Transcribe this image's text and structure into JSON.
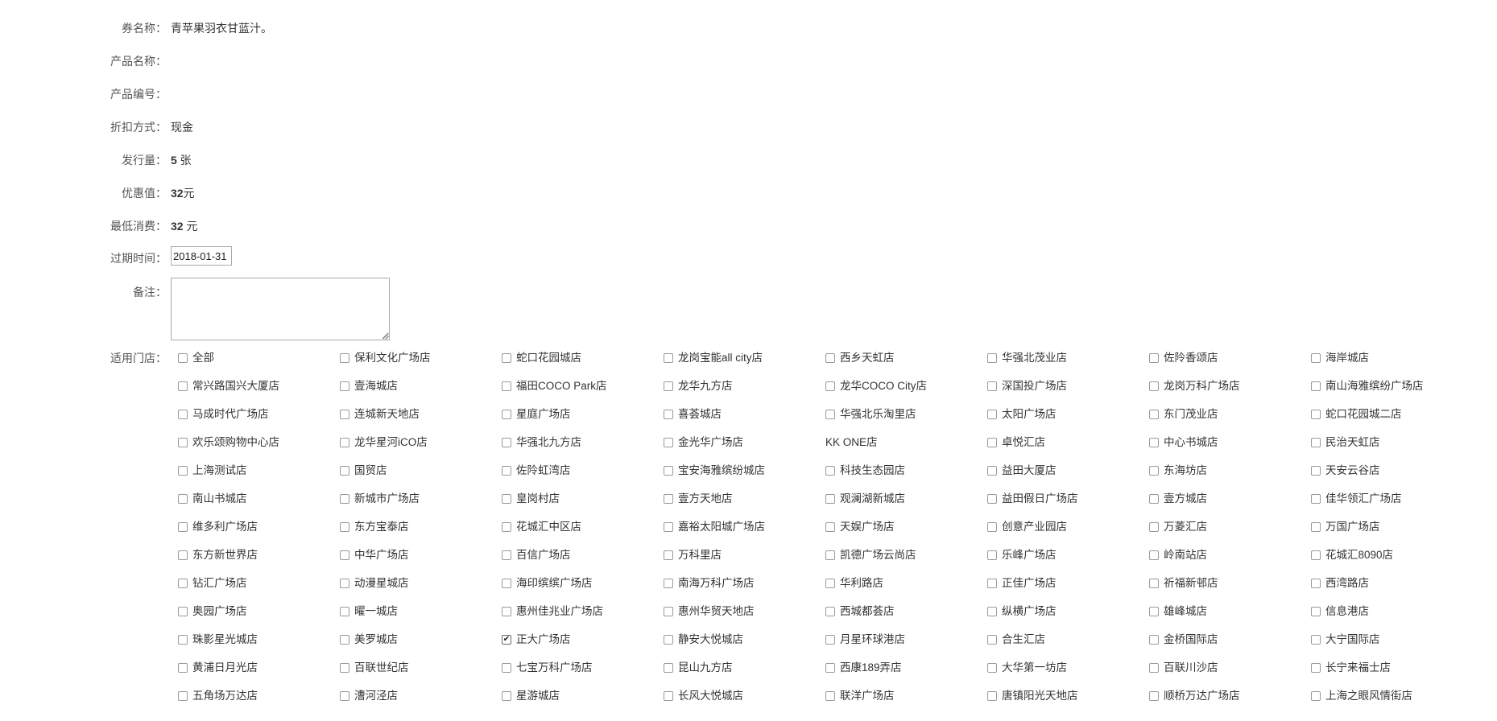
{
  "form": {
    "coupon_name": {
      "label": "券名称：",
      "value": "青苹果羽衣甘蓝汁。"
    },
    "product_name": {
      "label": "产品名称：",
      "value": ""
    },
    "product_code": {
      "label": "产品编号：",
      "value": ""
    },
    "discount_type": {
      "label": "折扣方式：",
      "value": "现金"
    },
    "issue_qty": {
      "label": "发行量：",
      "value": "5",
      "unit": " 张"
    },
    "discount_value": {
      "label": "优惠值：",
      "value": "32",
      "unit": "元"
    },
    "min_spend": {
      "label": "最低消费：",
      "value": "32",
      "unit": " 元"
    },
    "expiry": {
      "label": "过期时间：",
      "value": "2018-01-31"
    },
    "note": {
      "label": "备注：",
      "value": ""
    },
    "stores_label": "适用门店："
  },
  "stores": [
    {
      "name": "全部",
      "checked": false
    },
    {
      "name": "保利文化广场店",
      "checked": false
    },
    {
      "name": "蛇口花园城店",
      "checked": false
    },
    {
      "name": "龙岗宝能all city店",
      "checked": false
    },
    {
      "name": "西乡天虹店",
      "checked": false
    },
    {
      "name": "华强北茂业店",
      "checked": false
    },
    {
      "name": "佐阾香颂店",
      "checked": false
    },
    {
      "name": "海岸城店",
      "checked": false
    },
    {
      "name": "常兴路国兴大厦店",
      "checked": false
    },
    {
      "name": "壹海城店",
      "checked": false
    },
    {
      "name": "福田COCO Park店",
      "checked": false
    },
    {
      "name": "龙华九方店",
      "checked": false
    },
    {
      "name": "龙华COCO City店",
      "checked": false
    },
    {
      "name": "深国投广场店",
      "checked": false
    },
    {
      "name": "龙岗万科广场店",
      "checked": false
    },
    {
      "name": "南山海雅缤纷广场店",
      "checked": false
    },
    {
      "name": "马成时代广场店",
      "checked": false
    },
    {
      "name": "连城新天地店",
      "checked": false
    },
    {
      "name": "星庭广场店",
      "checked": false
    },
    {
      "name": "喜荟城店",
      "checked": false
    },
    {
      "name": "华强北乐淘里店",
      "checked": false
    },
    {
      "name": "太阳广场店",
      "checked": false
    },
    {
      "name": "东门茂业店",
      "checked": false
    },
    {
      "name": "蛇口花园城二店",
      "checked": false
    },
    {
      "name": "欢乐颂购物中心店",
      "checked": false
    },
    {
      "name": "龙华星河iCO店",
      "checked": false
    },
    {
      "name": "华强北九方店",
      "checked": false
    },
    {
      "name": "金光华广场店",
      "checked": false
    },
    {
      "name": "KK ONE店",
      "checked": false,
      "no_checkbox": true
    },
    {
      "name": "卓悦汇店",
      "checked": false
    },
    {
      "name": "中心书城店",
      "checked": false
    },
    {
      "name": "民治天虹店",
      "checked": false
    },
    {
      "name": "上海测试店",
      "checked": false
    },
    {
      "name": "国贸店",
      "checked": false
    },
    {
      "name": "佐阾虹湾店",
      "checked": false
    },
    {
      "name": "宝安海雅缤纷城店",
      "checked": false
    },
    {
      "name": "科技生态园店",
      "checked": false
    },
    {
      "name": "益田大厦店",
      "checked": false
    },
    {
      "name": "东海坊店",
      "checked": false
    },
    {
      "name": "天安云谷店",
      "checked": false
    },
    {
      "name": "南山书城店",
      "checked": false
    },
    {
      "name": "新城市广场店",
      "checked": false
    },
    {
      "name": "皇岗村店",
      "checked": false
    },
    {
      "name": "壹方天地店",
      "checked": false
    },
    {
      "name": "观澜湖新城店",
      "checked": false
    },
    {
      "name": "益田假日广场店",
      "checked": false
    },
    {
      "name": "壹方城店",
      "checked": false
    },
    {
      "name": "佳华领汇广场店",
      "checked": false
    },
    {
      "name": "维多利广场店",
      "checked": false
    },
    {
      "name": "东方宝泰店",
      "checked": false
    },
    {
      "name": "花城汇中区店",
      "checked": false
    },
    {
      "name": "嘉裕太阳城广场店",
      "checked": false
    },
    {
      "name": "天娱广场店",
      "checked": false
    },
    {
      "name": "创意产业园店",
      "checked": false
    },
    {
      "name": "万菱汇店",
      "checked": false
    },
    {
      "name": "万国广场店",
      "checked": false
    },
    {
      "name": "东方新世界店",
      "checked": false
    },
    {
      "name": "中华广场店",
      "checked": false
    },
    {
      "name": "百信广场店",
      "checked": false
    },
    {
      "name": "万科里店",
      "checked": false
    },
    {
      "name": "凯德广场云尚店",
      "checked": false
    },
    {
      "name": "乐峰广场店",
      "checked": false
    },
    {
      "name": "岭南站店",
      "checked": false
    },
    {
      "name": "花城汇8090店",
      "checked": false
    },
    {
      "name": "钻汇广场店",
      "checked": false
    },
    {
      "name": "动漫星城店",
      "checked": false
    },
    {
      "name": "海印缤缤广场店",
      "checked": false
    },
    {
      "name": "南海万科广场店",
      "checked": false
    },
    {
      "name": "华利路店",
      "checked": false
    },
    {
      "name": "正佳广场店",
      "checked": false
    },
    {
      "name": "祈福新邨店",
      "checked": false
    },
    {
      "name": "西湾路店",
      "checked": false
    },
    {
      "name": "奥园广场店",
      "checked": false
    },
    {
      "name": "曜一城店",
      "checked": false
    },
    {
      "name": "惠州佳兆业广场店",
      "checked": false
    },
    {
      "name": "惠州华贸天地店",
      "checked": false
    },
    {
      "name": "西城都荟店",
      "checked": false
    },
    {
      "name": "纵横广场店",
      "checked": false
    },
    {
      "name": "雄峰城店",
      "checked": false
    },
    {
      "name": "信息港店",
      "checked": false
    },
    {
      "name": "珠影星光城店",
      "checked": false
    },
    {
      "name": "美罗城店",
      "checked": false
    },
    {
      "name": "正大广场店",
      "checked": true
    },
    {
      "name": "静安大悦城店",
      "checked": false
    },
    {
      "name": "月星环球港店",
      "checked": false
    },
    {
      "name": "合生汇店",
      "checked": false
    },
    {
      "name": "金桥国际店",
      "checked": false
    },
    {
      "name": "大宁国际店",
      "checked": false
    },
    {
      "name": "黄浦日月光店",
      "checked": false
    },
    {
      "name": "百联世纪店",
      "checked": false
    },
    {
      "name": "七宝万科广场店",
      "checked": false
    },
    {
      "name": "昆山九方店",
      "checked": false
    },
    {
      "name": "西康189弄店",
      "checked": false
    },
    {
      "name": "大华第一坊店",
      "checked": false
    },
    {
      "name": "百联川沙店",
      "checked": false
    },
    {
      "name": "长宁来福士店",
      "checked": false
    },
    {
      "name": "五角场万达店",
      "checked": false
    },
    {
      "name": "漕河泾店",
      "checked": false
    },
    {
      "name": "星游城店",
      "checked": false
    },
    {
      "name": "长风大悦城店",
      "checked": false
    },
    {
      "name": "联洋广场店",
      "checked": false
    },
    {
      "name": "唐镇阳光天地店",
      "checked": false
    },
    {
      "name": "顺桥万达广场店",
      "checked": false
    },
    {
      "name": "上海之眼风情街店",
      "checked": false
    }
  ]
}
